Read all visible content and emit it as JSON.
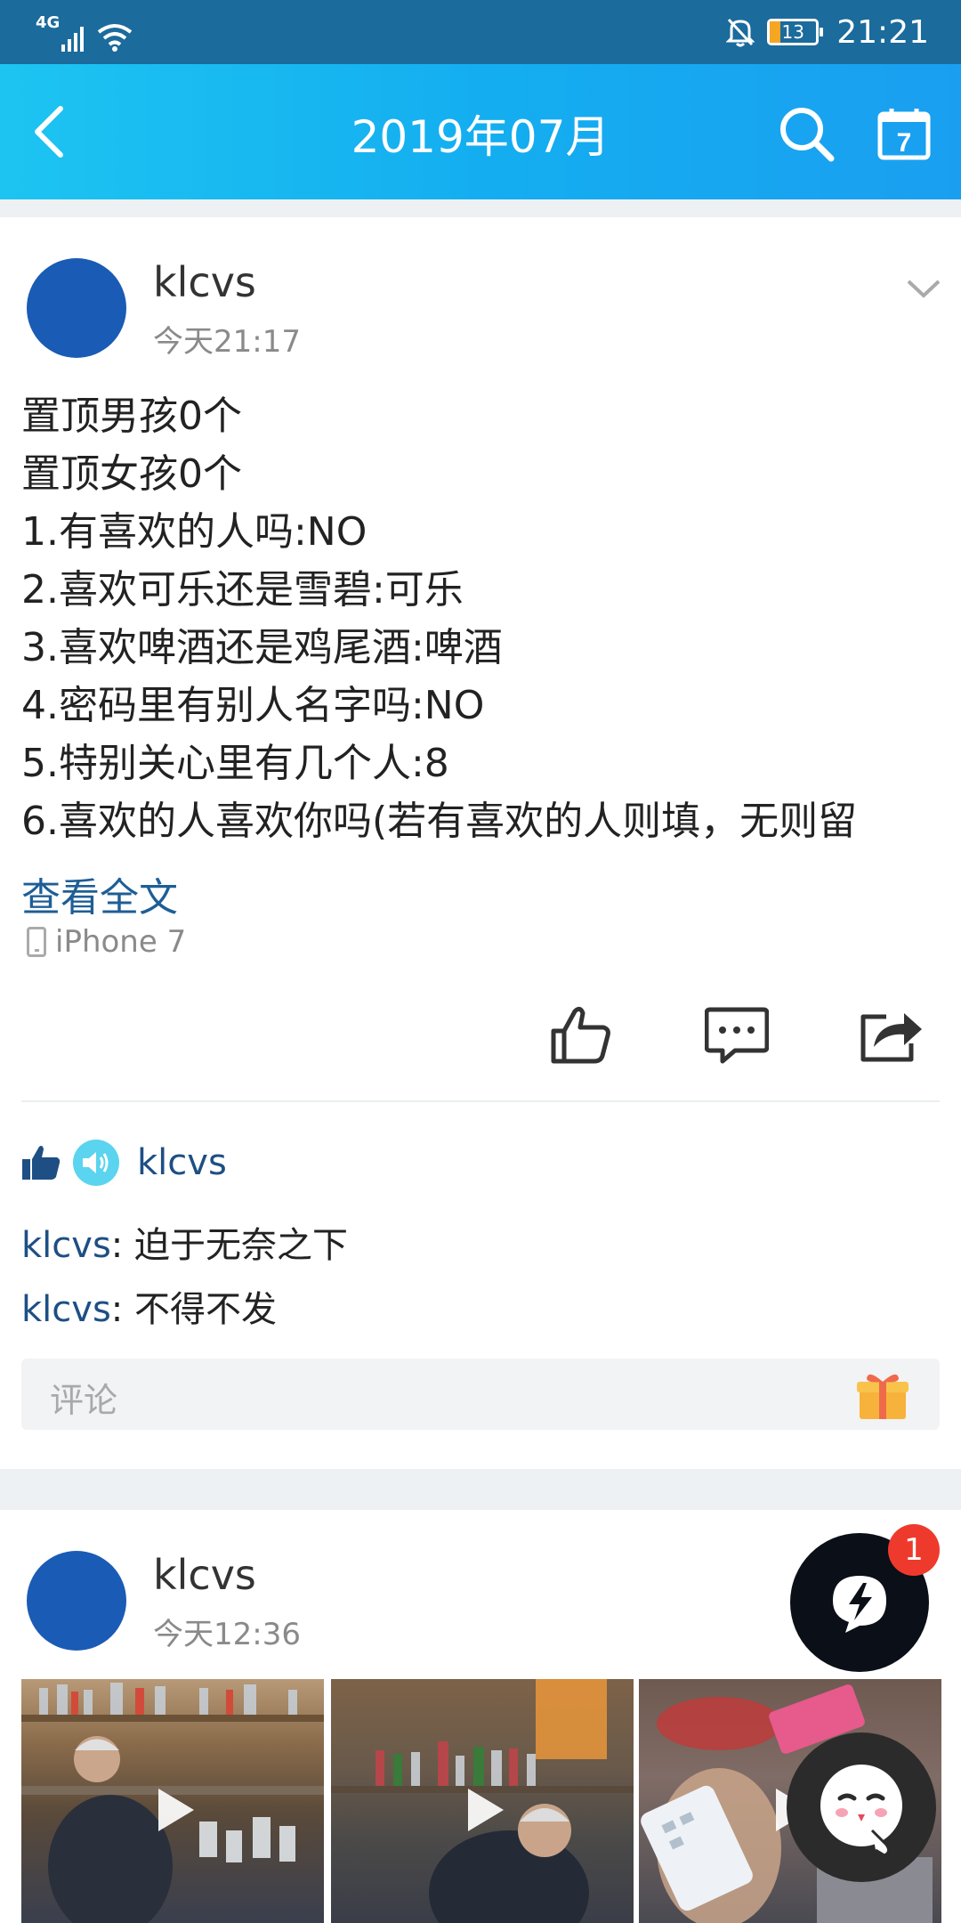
{
  "status_bar": {
    "network": "4G",
    "battery": "13",
    "time": "21:21"
  },
  "header": {
    "title": "2019年07月"
  },
  "post1": {
    "username": "klcvs",
    "time": "今天21:17",
    "lines": [
      "置顶男孩0个",
      "置顶女孩0个",
      "1.有喜欢的人吗:NO",
      "2.喜欢可乐还是雪碧:可乐",
      "3.喜欢啤酒还是鸡尾酒:啤酒",
      "4.密码里有别人名字吗:NO",
      "5.特别关心里有几个人:8",
      "6.喜欢的人喜欢你吗(若有喜欢的人则填，无则留"
    ],
    "read_more": "查看全文",
    "device": "iPhone 7",
    "liker": "klcvs",
    "comments": [
      {
        "name": "klcvs",
        "sep": ": ",
        "text": "迫于无奈之下"
      },
      {
        "name": "klcvs",
        "sep": ": ",
        "text": "不得不发"
      }
    ],
    "comment_placeholder": "评论"
  },
  "post2": {
    "username": "klcvs",
    "time": "今天12:36"
  },
  "fab": {
    "badge_count": "1"
  },
  "icons": [
    "back-icon",
    "search-icon",
    "calendar-icon",
    "chevron-down-icon",
    "phone-icon",
    "like-icon",
    "comment-icon",
    "share-icon",
    "gift-icon",
    "lightning-chat-icon",
    "play-icon"
  ]
}
